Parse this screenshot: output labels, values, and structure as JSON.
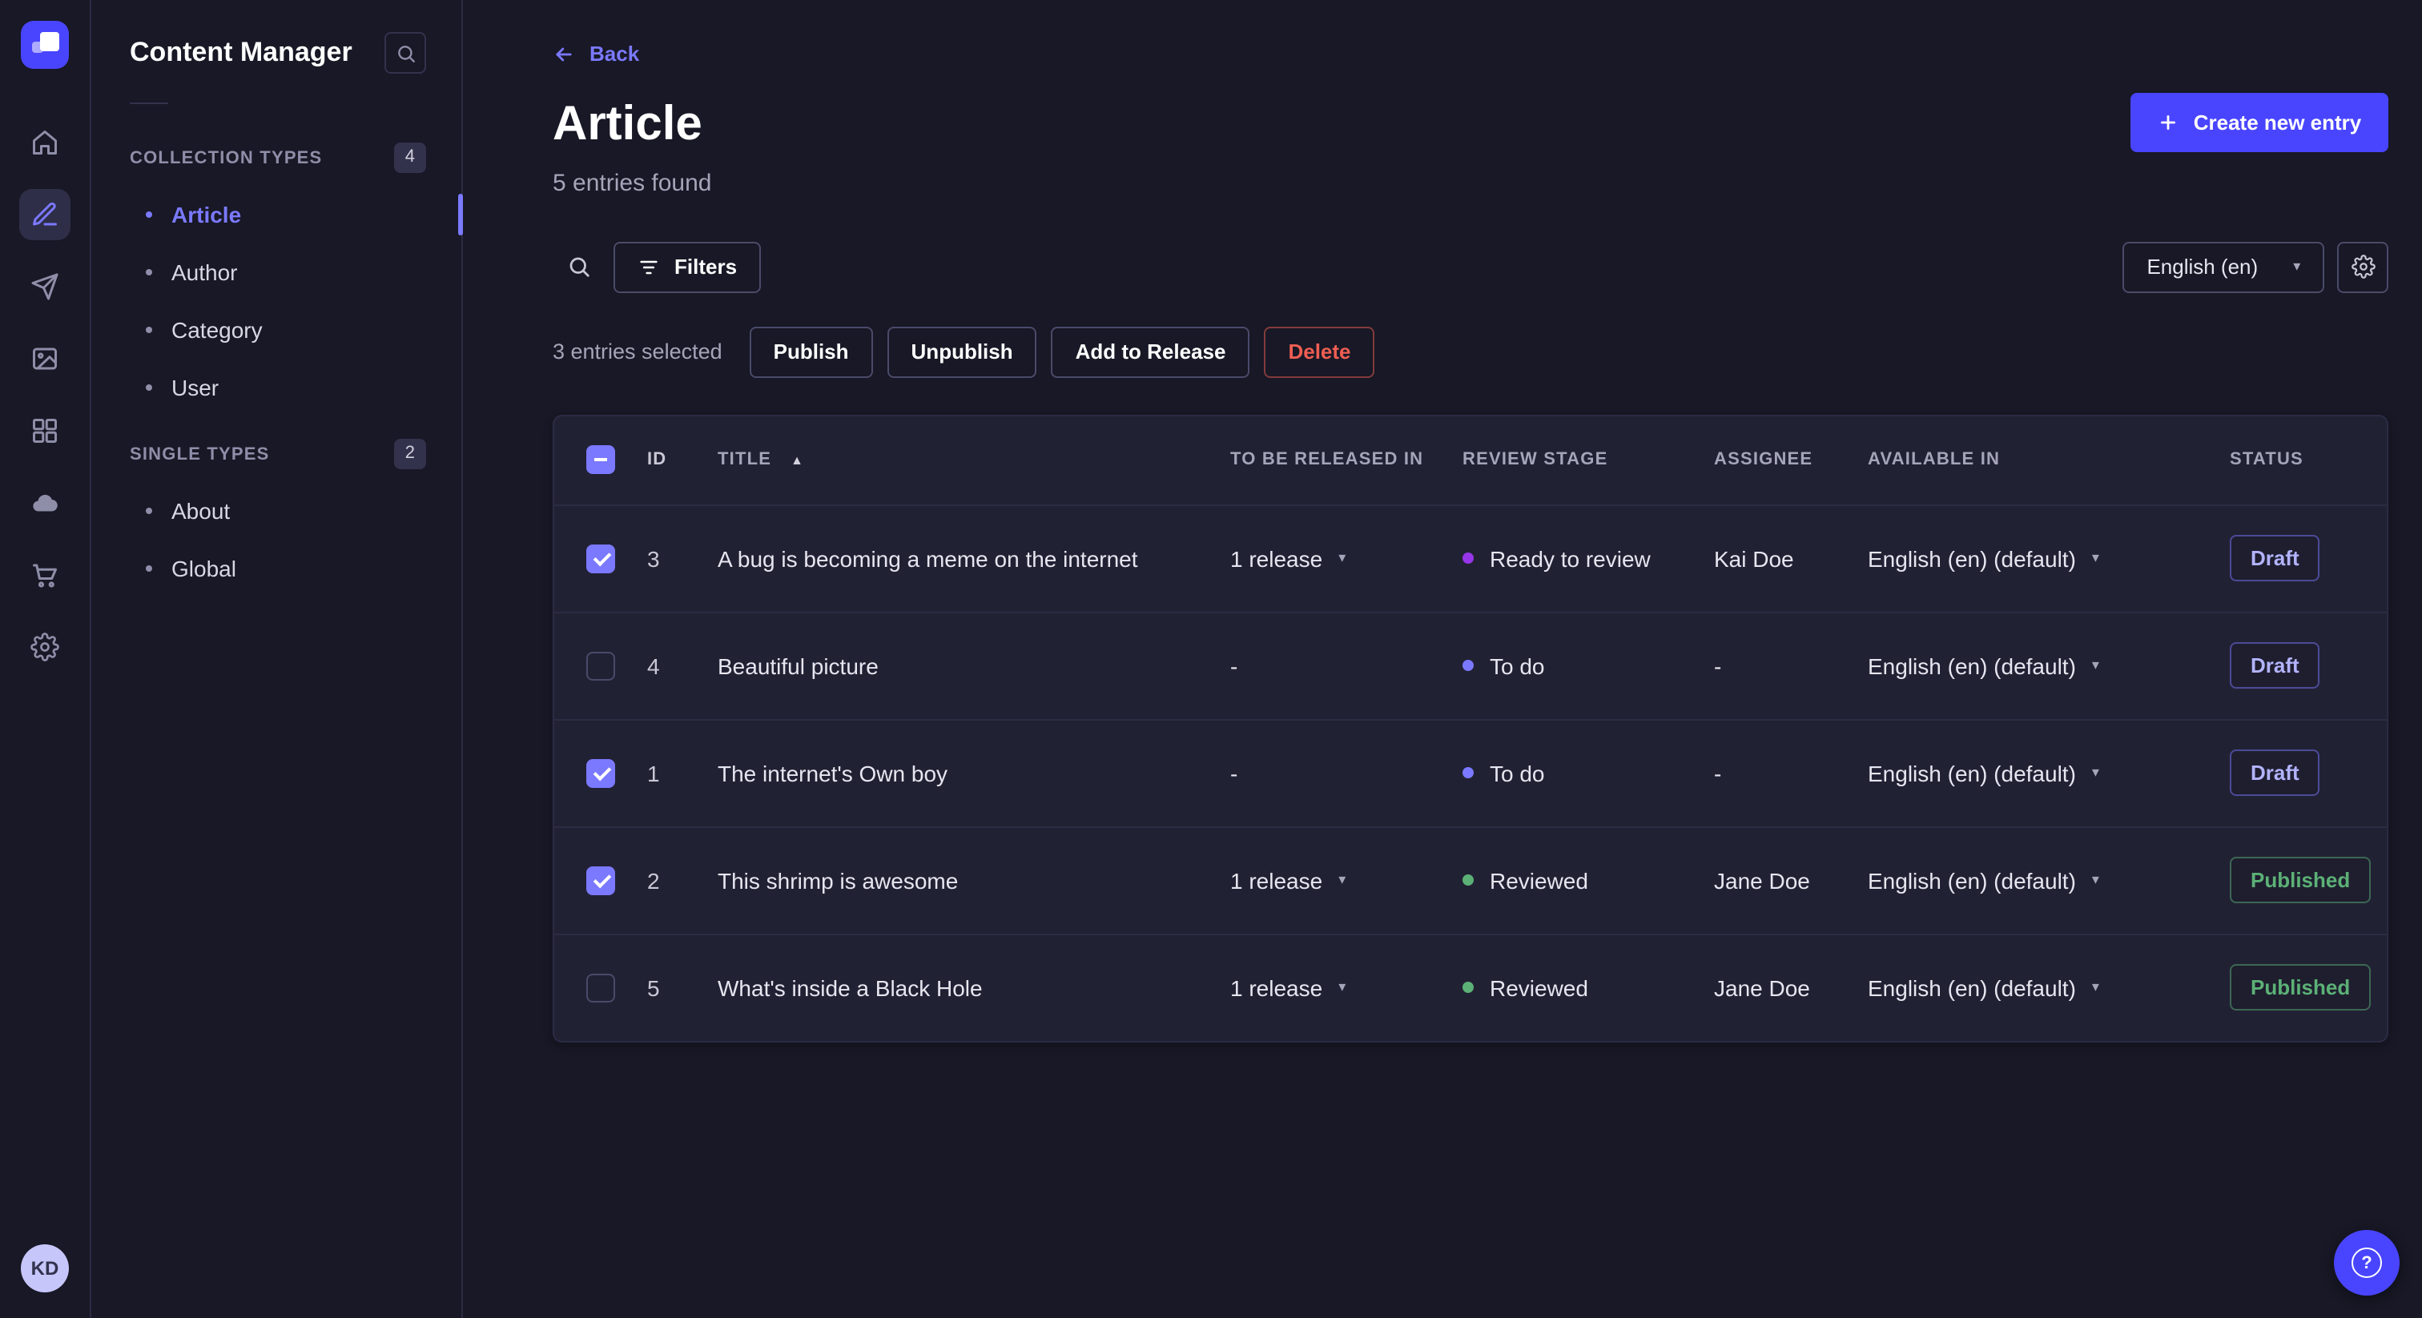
{
  "nav_rail": {
    "icons": [
      "strapi-logo",
      "home-icon",
      "content-manager-icon",
      "releases-icon",
      "media-library-icon",
      "content-type-builder-icon",
      "cloud-icon",
      "marketplace-icon",
      "settings-icon"
    ],
    "active_icon": "content-manager-icon",
    "avatar_initials": "KD"
  },
  "sidebar": {
    "title": "Content Manager",
    "search_icon": "search-icon",
    "sections": [
      {
        "label": "COLLECTION TYPES",
        "badge": "4",
        "items": [
          {
            "label": "Article",
            "active": true
          },
          {
            "label": "Author",
            "active": false
          },
          {
            "label": "Category",
            "active": false
          },
          {
            "label": "User",
            "active": false
          }
        ]
      },
      {
        "label": "SINGLE TYPES",
        "badge": "2",
        "items": [
          {
            "label": "About",
            "active": false
          },
          {
            "label": "Global",
            "active": false
          }
        ]
      }
    ]
  },
  "header": {
    "back_label": "Back",
    "title": "Article",
    "subtitle": "5 entries found",
    "create_button_label": "Create new entry"
  },
  "toolbar": {
    "filters_label": "Filters",
    "locale_selected": "English (en)"
  },
  "selection_bar": {
    "selected_text": "3 entries selected",
    "buttons": {
      "publish": "Publish",
      "unpublish": "Unpublish",
      "add_to_release": "Add to Release",
      "delete": "Delete"
    }
  },
  "table": {
    "select_all_state": "indeterminate",
    "headers": {
      "id": "ID",
      "title": "TITLE",
      "release": "TO BE RELEASED IN",
      "review_stage": "REVIEW STAGE",
      "assignee": "ASSIGNEE",
      "available_in": "AVAILABLE IN",
      "status": "STATUS"
    },
    "sort": {
      "column": "TITLE",
      "direction": "asc"
    },
    "rows": [
      {
        "checked": true,
        "id": "3",
        "title": "A bug is becoming a meme on the internet",
        "release": "1 release",
        "release_caret": true,
        "stage": "Ready to review",
        "stage_color": "#9736e8",
        "assignee": "Kai Doe",
        "available_in": "English (en) (default)",
        "status": "Draft",
        "status_variant": "draft"
      },
      {
        "checked": false,
        "id": "4",
        "title": "Beautiful picture",
        "release": "-",
        "release_caret": false,
        "stage": "To do",
        "stage_color": "#7b79ff",
        "assignee": "-",
        "available_in": "English (en) (default)",
        "status": "Draft",
        "status_variant": "draft"
      },
      {
        "checked": true,
        "id": "1",
        "title": "The internet's Own boy",
        "release": "-",
        "release_caret": false,
        "stage": "To do",
        "stage_color": "#7b79ff",
        "assignee": "-",
        "available_in": "English (en) (default)",
        "status": "Draft",
        "status_variant": "draft"
      },
      {
        "checked": true,
        "id": "2",
        "title": "This shrimp is awesome",
        "release": "1 release",
        "release_caret": true,
        "stage": "Reviewed",
        "stage_color": "#5cb176",
        "assignee": "Jane Doe",
        "available_in": "English (en) (default)",
        "status": "Published",
        "status_variant": "published"
      },
      {
        "checked": false,
        "id": "5",
        "title": "What's inside a Black Hole",
        "release": "1 release",
        "release_caret": true,
        "stage": "Reviewed",
        "stage_color": "#5cb176",
        "assignee": "Jane Doe",
        "available_in": "English (en) (default)",
        "status": "Published",
        "status_variant": "published"
      }
    ]
  },
  "colors": {
    "accent": "#4945ff",
    "link": "#7b79ff",
    "draft_text": "#b3b3ff",
    "published_text": "#5cb176",
    "danger_text": "#ee5e52",
    "stage_ready_to_review": "#9736e8",
    "stage_to_do": "#7b79ff",
    "stage_reviewed": "#5cb176"
  },
  "help_button": {
    "icon": "question-mark-icon"
  }
}
